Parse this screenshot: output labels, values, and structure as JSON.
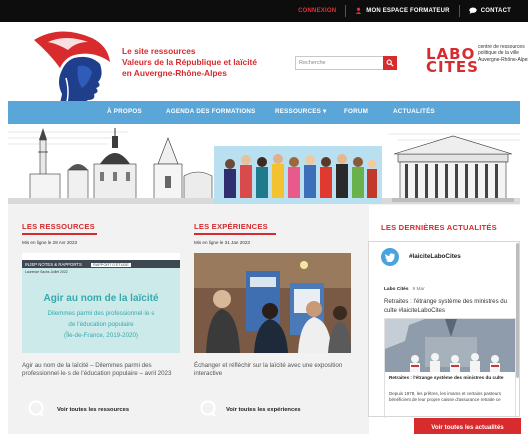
{
  "topbar": {
    "connexion": "CONNEXION",
    "espace": "MON ESPACE FORMATEUR",
    "contact": "CONTACT"
  },
  "header": {
    "title_line1": "Le site ressources",
    "title_line2": "Valeurs de la République et laïcité",
    "title_line3": "en Auvergne-Rhône-Alpes",
    "search_placeholder": "Recherche",
    "labo_line1": "LABO",
    "labo_line2": "CITES",
    "labo_sub": "centre de ressources politique de la ville Auvergne-Rhône-Alpes"
  },
  "nav": {
    "items": [
      "À PROPOS",
      "AGENDA DES FORMATIONS",
      "RESSOURCES ▾",
      "FORUM",
      "ACTUALITÉS"
    ]
  },
  "ressources": {
    "title": "LES RESSOURCES",
    "date": "Mis en ligne le 28 Avr 2023",
    "img_band": "INJEP NOTES & RAPPORTS",
    "img_tag": "RAPPORT D'ÉTUDE",
    "img_mini": "Laurence Sachs\nJuillet 2022",
    "img_heading": "Agir au nom de la laïcité",
    "img_sub1": "Dilemmes parmi des professionnel·le·s",
    "img_sub2": "de l'éducation populaire",
    "img_sub3": "(Île-de-France, 2019-2020)",
    "text": "Agir au nom de la laïcité – Dilemmes parmi des professionnel·le·s de l'éducation populaire – avril 2023",
    "see_all": "Voir toutes les ressources"
  },
  "experiences": {
    "title": "LES EXPÉRIENCES",
    "date": "Mis en ligne le 31 Jan 2023",
    "text": "Échanger et réfléchir sur la laïcité avec une exposition interactive",
    "see_all": "Voir toutes les expériences"
  },
  "actualites": {
    "title": "LES DERNIÈRES ACTUALITÉS",
    "hashtag": "#laiciteLaboCites",
    "author": "Labo Cités",
    "date": "9 Mar",
    "tweet": "Retraites : l'étrange système des ministres du culte #laiciteLaboCites",
    "card_title": "Retraites : l'étrange système des ministres du culte",
    "card_desc": "Depuis 1978, les prêtres, les imams et certains pasteurs bénéficient de leur propre caisse d'assurance retraite ce",
    "button": "Voir toutes les actualités"
  },
  "colors": {
    "brand_red": "#d72b2e",
    "nav_blue": "#5aa6d8",
    "twitter_blue": "#4aa3df"
  }
}
